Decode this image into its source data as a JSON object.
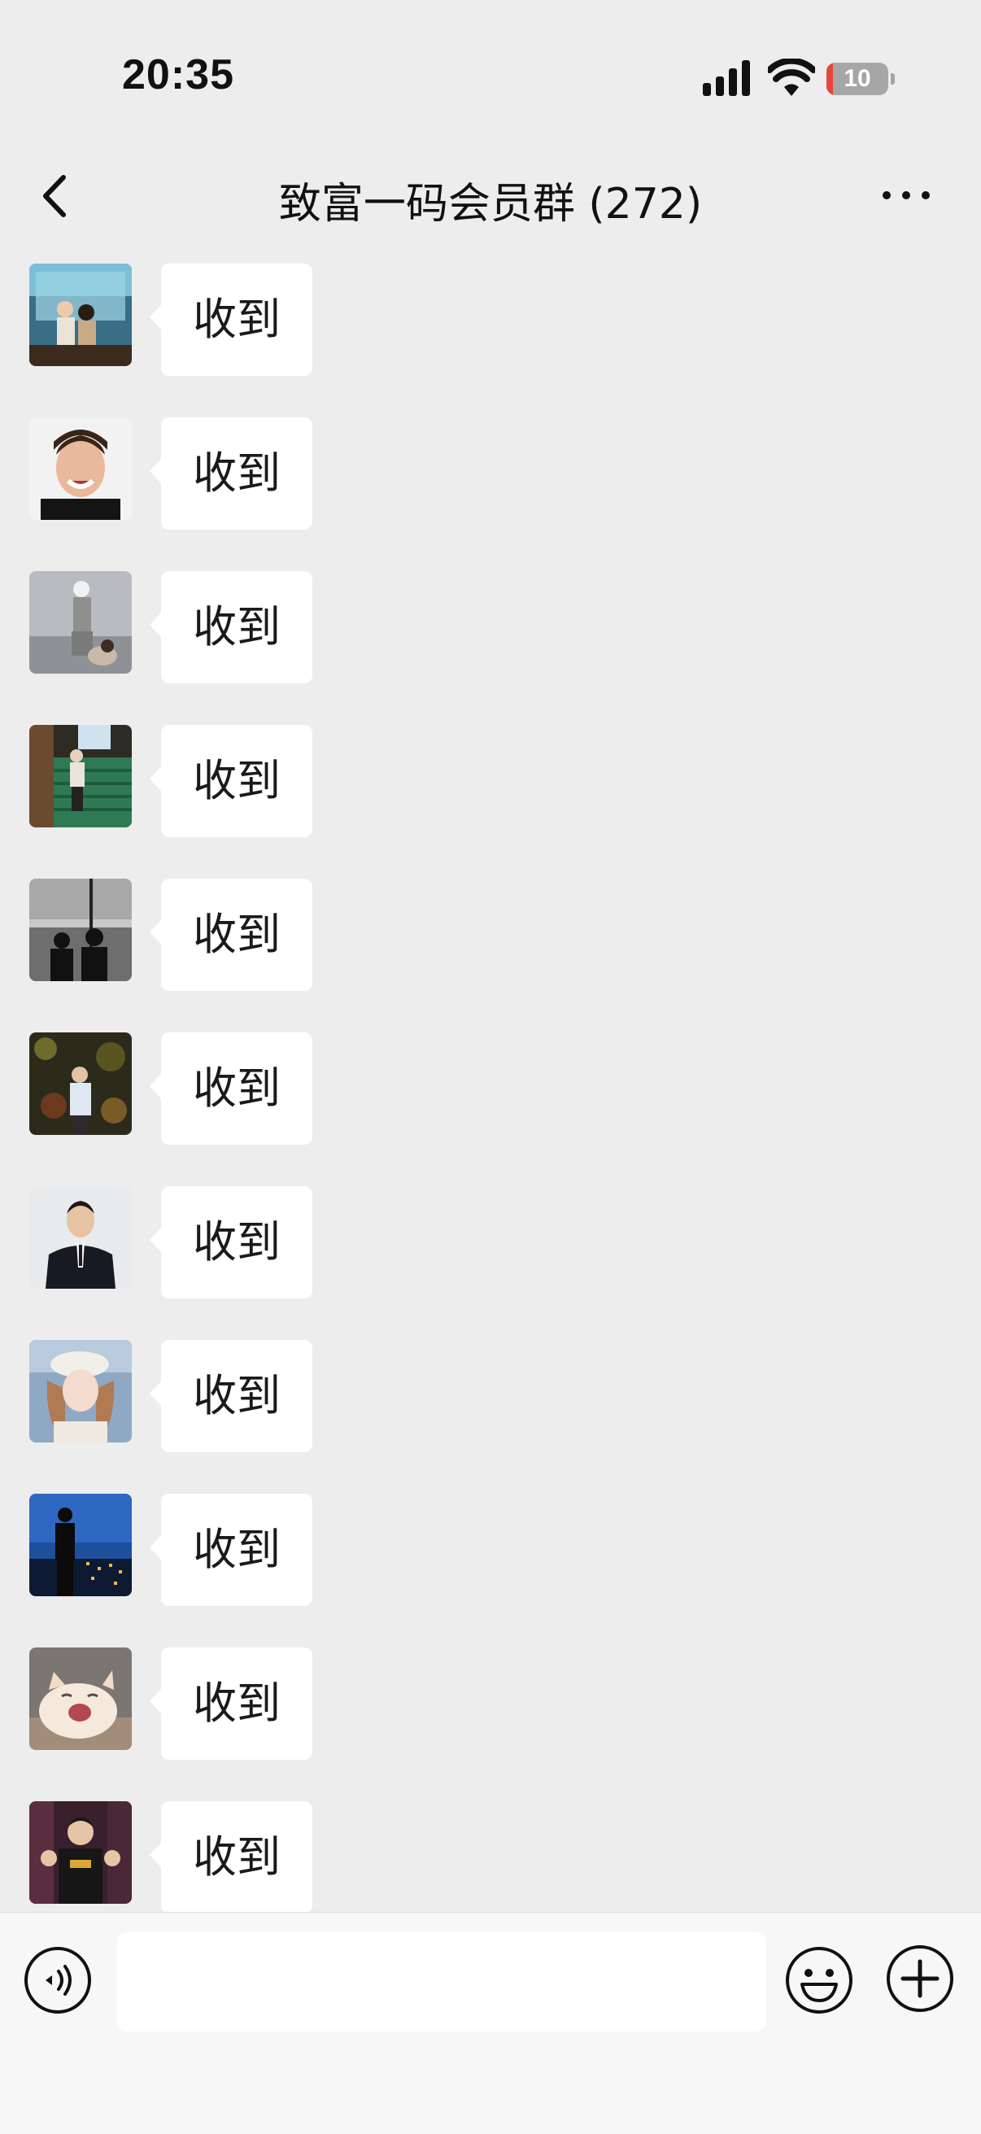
{
  "status_bar": {
    "time": "20:35",
    "battery_level": "10",
    "battery_fraction": 0.1,
    "battery_color": "#e8453c",
    "signal_icon": "signal-bars-icon",
    "wifi_icon": "wifi-icon"
  },
  "nav": {
    "title": "致富一码会员群 (272)",
    "back_icon": "chevron-left-icon",
    "more_icon": "more-dots-icon"
  },
  "messages": [
    {
      "text": "收到",
      "avatar": "photo-couple-stage"
    },
    {
      "text": "收到",
      "avatar": "photo-smiling-man"
    },
    {
      "text": "收到",
      "avatar": "photo-woman-with-dog"
    },
    {
      "text": "收到",
      "avatar": "photo-stairs-man"
    },
    {
      "text": "收到",
      "avatar": "photo-silhouette-couple"
    },
    {
      "text": "收到",
      "avatar": "photo-man-in-woods"
    },
    {
      "text": "收到",
      "avatar": "photo-man-in-suit"
    },
    {
      "text": "收到",
      "avatar": "photo-woman-beret"
    },
    {
      "text": "收到",
      "avatar": "photo-man-city-night"
    },
    {
      "text": "收到",
      "avatar": "photo-yawning-cat"
    },
    {
      "text": "收到",
      "avatar": "photo-man-gym"
    }
  ],
  "input_bar": {
    "voice_icon": "voice-icon",
    "emoji_icon": "emoji-icon",
    "plus_icon": "plus-icon",
    "input_value": ""
  },
  "colors": {
    "background": "#ededed",
    "bubble": "#ffffff",
    "input_bar": "#f7f7f7"
  }
}
